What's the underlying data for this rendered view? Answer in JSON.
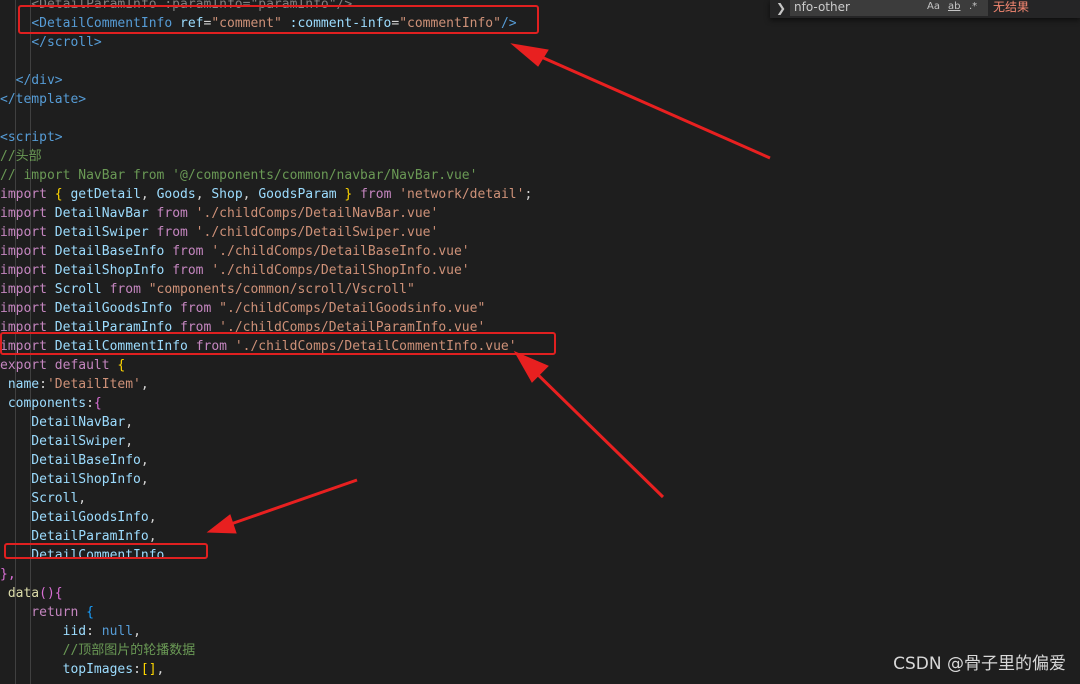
{
  "editor": {
    "lines": [
      {
        "segments": [
          {
            "t": "    <DetailParamInfo :paramInfo=\"paramInfo\"/>",
            "c": "t-gray"
          }
        ]
      },
      {
        "segments": [
          {
            "t": "    ",
            "c": "t-punc"
          },
          {
            "t": "<DetailCommentInfo",
            "c": "t-tag"
          },
          {
            "t": " ref",
            "c": "t-attr"
          },
          {
            "t": "=",
            "c": "t-punc"
          },
          {
            "t": "\"comment\"",
            "c": "t-str"
          },
          {
            "t": " :comment-info",
            "c": "t-attr"
          },
          {
            "t": "=",
            "c": "t-punc"
          },
          {
            "t": "\"commentInfo\"",
            "c": "t-str"
          },
          {
            "t": "/>",
            "c": "t-tag"
          }
        ]
      },
      {
        "segments": [
          {
            "t": "    ",
            "c": "t-punc"
          },
          {
            "t": "</scroll>",
            "c": "t-tag"
          }
        ]
      },
      {
        "segments": []
      },
      {
        "segments": [
          {
            "t": "  ",
            "c": "t-punc"
          },
          {
            "t": "</div>",
            "c": "t-tag"
          }
        ]
      },
      {
        "segments": [
          {
            "t": "</template>",
            "c": "t-tag"
          }
        ]
      },
      {
        "segments": []
      },
      {
        "segments": [
          {
            "t": "<script>",
            "c": "t-tag"
          }
        ]
      },
      {
        "segments": [
          {
            "t": "//头部",
            "c": "t-comment"
          }
        ]
      },
      {
        "segments": [
          {
            "t": "// import NavBar from '@/components/common/navbar/NavBar.vue'",
            "c": "t-comment"
          }
        ]
      },
      {
        "segments": [
          {
            "t": "import",
            "c": "t-kw"
          },
          {
            "t": " { ",
            "c": "t-brace"
          },
          {
            "t": "getDetail",
            "c": "t-var"
          },
          {
            "t": ", ",
            "c": "t-punc"
          },
          {
            "t": "Goods",
            "c": "t-var"
          },
          {
            "t": ", ",
            "c": "t-punc"
          },
          {
            "t": "Shop",
            "c": "t-var"
          },
          {
            "t": ", ",
            "c": "t-punc"
          },
          {
            "t": "GoodsParam",
            "c": "t-var"
          },
          {
            "t": " } ",
            "c": "t-brace"
          },
          {
            "t": "from",
            "c": "t-kw"
          },
          {
            "t": " 'network/detail'",
            "c": "t-str"
          },
          {
            "t": ";",
            "c": "t-punc"
          }
        ]
      },
      {
        "segments": [
          {
            "t": "import",
            "c": "t-kw"
          },
          {
            "t": " DetailNavBar ",
            "c": "t-var"
          },
          {
            "t": "from",
            "c": "t-kw"
          },
          {
            "t": " './childComps/DetailNavBar.vue'",
            "c": "t-str"
          }
        ]
      },
      {
        "segments": [
          {
            "t": "import",
            "c": "t-kw"
          },
          {
            "t": " DetailSwiper ",
            "c": "t-var"
          },
          {
            "t": "from",
            "c": "t-kw"
          },
          {
            "t": " './childComps/DetailSwiper.vue'",
            "c": "t-str"
          }
        ]
      },
      {
        "segments": [
          {
            "t": "import",
            "c": "t-kw"
          },
          {
            "t": " DetailBaseInfo ",
            "c": "t-var"
          },
          {
            "t": "from",
            "c": "t-kw"
          },
          {
            "t": " './childComps/DetailBaseInfo.vue'",
            "c": "t-str"
          }
        ]
      },
      {
        "segments": [
          {
            "t": "import",
            "c": "t-kw"
          },
          {
            "t": " DetailShopInfo ",
            "c": "t-var"
          },
          {
            "t": "from",
            "c": "t-kw"
          },
          {
            "t": " './childComps/DetailShopInfo.vue'",
            "c": "t-str"
          }
        ]
      },
      {
        "segments": [
          {
            "t": "import",
            "c": "t-kw"
          },
          {
            "t": " Scroll ",
            "c": "t-var"
          },
          {
            "t": "from",
            "c": "t-kw"
          },
          {
            "t": " \"components/common/scroll/Vscroll\"",
            "c": "t-str"
          }
        ]
      },
      {
        "segments": [
          {
            "t": "import",
            "c": "t-kw"
          },
          {
            "t": " DetailGoodsInfo ",
            "c": "t-var"
          },
          {
            "t": "from",
            "c": "t-kw"
          },
          {
            "t": " \"./childComps/DetailGoodsinfo.vue\"",
            "c": "t-str"
          }
        ]
      },
      {
        "segments": [
          {
            "t": "import",
            "c": "t-kw"
          },
          {
            "t": " DetailParamInfo ",
            "c": "t-var"
          },
          {
            "t": "from",
            "c": "t-kw"
          },
          {
            "t": " './childComps/DetailParamInfo.vue'",
            "c": "t-str"
          }
        ]
      },
      {
        "segments": [
          {
            "t": "import",
            "c": "t-kw"
          },
          {
            "t": " DetailCommentInfo ",
            "c": "t-var"
          },
          {
            "t": "from",
            "c": "t-kw"
          },
          {
            "t": " './childComps/DetailCommentInfo.vue'",
            "c": "t-str"
          }
        ]
      },
      {
        "segments": [
          {
            "t": "export",
            "c": "t-kw"
          },
          {
            "t": " default",
            "c": "t-kw"
          },
          {
            "t": " {",
            "c": "t-brace"
          }
        ]
      },
      {
        "segments": [
          {
            "t": " name",
            "c": "t-var"
          },
          {
            "t": ":",
            "c": "t-punc"
          },
          {
            "t": "'DetailItem'",
            "c": "t-str"
          },
          {
            "t": ",",
            "c": "t-punc"
          }
        ]
      },
      {
        "segments": [
          {
            "t": " components",
            "c": "t-var"
          },
          {
            "t": ":",
            "c": "t-punc"
          },
          {
            "t": "{",
            "c": "t-brace2"
          }
        ]
      },
      {
        "segments": [
          {
            "t": "    DetailNavBar",
            "c": "t-var"
          },
          {
            "t": ",",
            "c": "t-punc"
          }
        ]
      },
      {
        "segments": [
          {
            "t": "    DetailSwiper",
            "c": "t-var"
          },
          {
            "t": ",",
            "c": "t-punc"
          }
        ]
      },
      {
        "segments": [
          {
            "t": "    DetailBaseInfo",
            "c": "t-var"
          },
          {
            "t": ",",
            "c": "t-punc"
          }
        ]
      },
      {
        "segments": [
          {
            "t": "    DetailShopInfo",
            "c": "t-var"
          },
          {
            "t": ",",
            "c": "t-punc"
          }
        ]
      },
      {
        "segments": [
          {
            "t": "    Scroll",
            "c": "t-var"
          },
          {
            "t": ",",
            "c": "t-punc"
          }
        ]
      },
      {
        "segments": [
          {
            "t": "    DetailGoodsInfo",
            "c": "t-var"
          },
          {
            "t": ",",
            "c": "t-punc"
          }
        ]
      },
      {
        "segments": [
          {
            "t": "    DetailParamInfo",
            "c": "t-var"
          },
          {
            "t": ",",
            "c": "t-punc"
          }
        ]
      },
      {
        "segments": [
          {
            "t": "    DetailCommentInfo",
            "c": "t-var"
          }
        ]
      },
      {
        "segments": [
          {
            "t": "},",
            "c": "t-brace2"
          }
        ]
      },
      {
        "segments": [
          {
            "t": " data",
            "c": "t-fn"
          },
          {
            "t": "()",
            "c": "t-brace2"
          },
          {
            "t": "{",
            "c": "t-brace2"
          }
        ]
      },
      {
        "segments": [
          {
            "t": "    return",
            "c": "t-kw"
          },
          {
            "t": " {",
            "c": "t-brace3"
          }
        ]
      },
      {
        "segments": [
          {
            "t": "        iid",
            "c": "t-var"
          },
          {
            "t": ": ",
            "c": "t-punc"
          },
          {
            "t": "null",
            "c": "t-null"
          },
          {
            "t": ",",
            "c": "t-punc"
          }
        ]
      },
      {
        "segments": [
          {
            "t": "        //顶部图片的轮播数据",
            "c": "t-comment"
          }
        ]
      },
      {
        "segments": [
          {
            "t": "        topImages",
            "c": "t-var"
          },
          {
            "t": ":",
            "c": "t-punc"
          },
          {
            "t": "[]",
            "c": "t-brace"
          },
          {
            "t": ",",
            "c": "t-punc"
          }
        ]
      }
    ]
  },
  "find": {
    "value": "nfo-other",
    "opt_case": "Aa",
    "opt_word": "ab",
    "opt_regex": ".*",
    "result": "无结果"
  },
  "watermark": "CSDN @骨子里的偏爱"
}
